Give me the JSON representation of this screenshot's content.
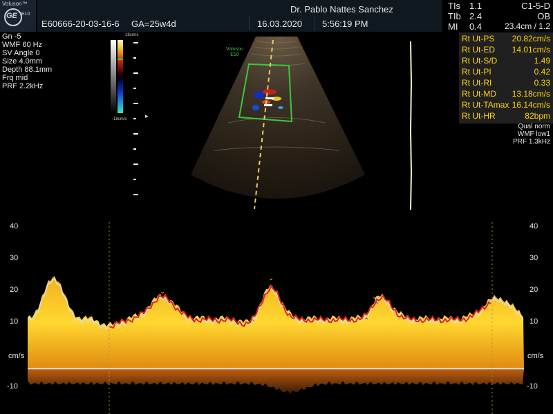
{
  "header": {
    "brand": "Voluson™",
    "model": "E10",
    "ge_logo": "GE",
    "patient_id": "E60666-20-03-16-6",
    "ga": "GA=25w4d",
    "doctor": "Dr. Pablo Nattes Sanchez",
    "date": "16.03.2020",
    "time": "5:56:19 PM",
    "tis_label": "TIs",
    "tis_value": "1.1",
    "tib_label": "TIb",
    "tib_value": "2.4",
    "mi_label": "MI",
    "mi_value": "0.4",
    "probe": "C1-5-D",
    "application": "OB",
    "depth_info": "23.4cm / 1.2"
  },
  "left_params": [
    "Gn  -5",
    "WMF 60 Hz",
    "SV Angle  0",
    "Size  4.0mm",
    "Depth 88.1mm",
    "Frq mid",
    "PRF  2.2kHz"
  ],
  "color_bar": {
    "top_label": "18cm/s",
    "bottom_label": "-18cm/s"
  },
  "bmode": {
    "watermark": "Voluson\nE10"
  },
  "measurements": [
    {
      "label": "Rt Ut-PS",
      "value": "20.82cm/s"
    },
    {
      "label": "Rt Ut-ED",
      "value": "14.01cm/s"
    },
    {
      "label": "Rt Ut-S/D",
      "value": "1.49"
    },
    {
      "label": "Rt Ut-PI",
      "value": "0.42"
    },
    {
      "label": "Rt Ut-RI",
      "value": "0.33"
    },
    {
      "label": "Rt Ut-MD",
      "value": "13.18cm/s"
    },
    {
      "label": "Rt Ut-TAmax",
      "value": "16.14cm/s"
    },
    {
      "label": "Rt Ut-HR",
      "value": "82bpm"
    }
  ],
  "spectral_params": [
    "Qual norm",
    "WMF low1",
    "PRF  1.3kHz"
  ],
  "spectral_axis": {
    "unit": "cm/s",
    "ticks": [
      40,
      30,
      20,
      10,
      -10
    ],
    "range": [
      -13,
      42
    ],
    "baseline": 0
  },
  "colors": {
    "measure_text": "#ffd400",
    "roi_box": "#3cc83c",
    "trace_red": "#e02020",
    "trace_white": "#dcdcdc"
  }
}
